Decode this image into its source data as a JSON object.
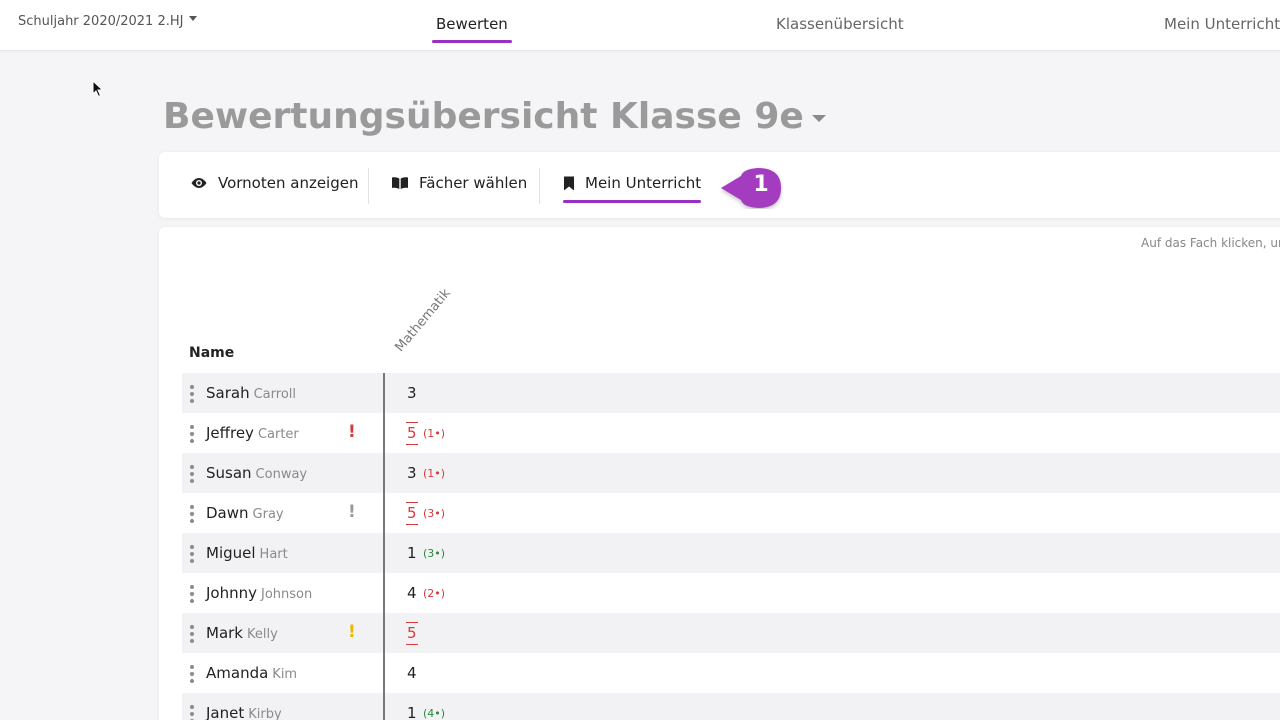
{
  "header": {
    "school_year": "Schuljahr 2020/2021 2.HJ",
    "tabs": [
      {
        "label": "Bewerten",
        "active": true
      },
      {
        "label": "Klassenübersicht",
        "active": false
      },
      {
        "label": "Mein Unterricht",
        "active": false
      }
    ]
  },
  "page": {
    "title": "Bewertungsübersicht Klasse 9e"
  },
  "toolbar": {
    "show_pre_grades": "Vornoten anzeigen",
    "choose_subjects": "Fächer wählen",
    "my_lessons": "Mein Unterricht",
    "callout_number": "1"
  },
  "table": {
    "hint": "Auf das Fach klicken, un",
    "name_header": "Name",
    "subject": "Mathematik",
    "rows": [
      {
        "first": "Sarah",
        "last": "Carroll",
        "grade": "3",
        "flagged": false,
        "sub": "",
        "sub_color": "",
        "warn_color": ""
      },
      {
        "first": "Jeffrey",
        "last": "Carter",
        "grade": "5",
        "flagged": true,
        "sub": "(1•)",
        "sub_color": "red",
        "warn_color": "#d63a3a"
      },
      {
        "first": "Susan",
        "last": "Conway",
        "grade": "3",
        "flagged": false,
        "sub": "(1•)",
        "sub_color": "red",
        "warn_color": ""
      },
      {
        "first": "Dawn",
        "last": "Gray",
        "grade": "5",
        "flagged": true,
        "sub": "(3•)",
        "sub_color": "red",
        "warn_color": "#9a9a9a"
      },
      {
        "first": "Miguel",
        "last": "Hart",
        "grade": "1",
        "flagged": false,
        "sub": "(3•)",
        "sub_color": "green",
        "warn_color": ""
      },
      {
        "first": "Johnny",
        "last": "Johnson",
        "grade": "4",
        "flagged": false,
        "sub": "(2•)",
        "sub_color": "red",
        "warn_color": ""
      },
      {
        "first": "Mark",
        "last": "Kelly",
        "grade": "5",
        "flagged": true,
        "sub": "",
        "sub_color": "",
        "warn_color": "#f0b400"
      },
      {
        "first": "Amanda",
        "last": "Kim",
        "grade": "4",
        "flagged": false,
        "sub": "",
        "sub_color": "",
        "warn_color": ""
      },
      {
        "first": "Janet",
        "last": "Kirby",
        "grade": "1",
        "flagged": false,
        "sub": "(4•)",
        "sub_color": "green",
        "warn_color": ""
      }
    ]
  },
  "colors": {
    "accent": "#9b2fc4",
    "warning_red": "#d63a3a",
    "positive_green": "#2a8a3a"
  }
}
